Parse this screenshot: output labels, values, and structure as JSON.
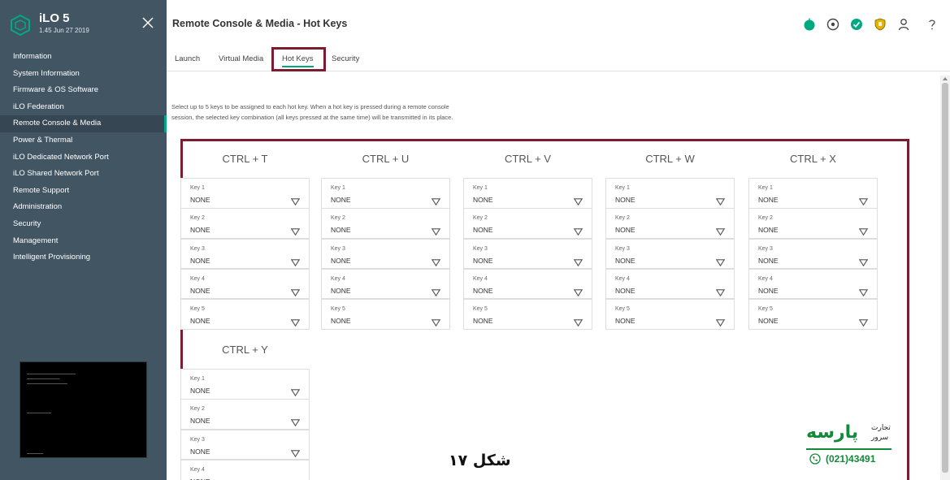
{
  "sidebar": {
    "app_name": "iLO 5",
    "version": "1.45 Jun 27 2019",
    "nav": [
      {
        "label": "Information",
        "active": false
      },
      {
        "label": "System Information",
        "active": false
      },
      {
        "label": "Firmware & OS Software",
        "active": false
      },
      {
        "label": "iLO Federation",
        "active": false
      },
      {
        "label": "Remote Console & Media",
        "active": true
      },
      {
        "label": "Power & Thermal",
        "active": false
      },
      {
        "label": "iLO Dedicated Network Port",
        "active": false
      },
      {
        "label": "iLO Shared Network Port",
        "active": false
      },
      {
        "label": "Remote Support",
        "active": false
      },
      {
        "label": "Administration",
        "active": false
      },
      {
        "label": "Security",
        "active": false
      },
      {
        "label": "Management",
        "active": false
      },
      {
        "label": "Intelligent Provisioning",
        "active": false
      }
    ]
  },
  "header": {
    "title": "Remote Console & Media - Hot Keys",
    "icons": [
      "health-status-icon",
      "target-icon",
      "check-status-icon",
      "security-shield-icon",
      "user-icon",
      "help-icon"
    ],
    "colors": {
      "health": "#01a982",
      "check": "#01a982",
      "shield": "#e6b400"
    }
  },
  "tabs": [
    {
      "label": "Launch",
      "active": false
    },
    {
      "label": "Virtual Media",
      "active": false
    },
    {
      "label": "Hot Keys",
      "active": true
    },
    {
      "label": "Security",
      "active": false
    }
  ],
  "main": {
    "description": "Select up to 5 keys to be assigned to each hot key. When a hot key is pressed during a remote console session, the selected key combination (all keys pressed at the same time) will be transmitted in its place.",
    "hotkeys": [
      {
        "title": "CTRL + T",
        "keys": [
          {
            "label": "Key 1",
            "value": "NONE"
          },
          {
            "label": "Key 2",
            "value": "NONE"
          },
          {
            "label": "Key 3",
            "value": "NONE"
          },
          {
            "label": "Key 4",
            "value": "NONE"
          },
          {
            "label": "Key 5",
            "value": "NONE"
          }
        ]
      },
      {
        "title": "CTRL + U",
        "keys": [
          {
            "label": "Key 1",
            "value": "NONE"
          },
          {
            "label": "Key 2",
            "value": "NONE"
          },
          {
            "label": "Key 3",
            "value": "NONE"
          },
          {
            "label": "Key 4",
            "value": "NONE"
          },
          {
            "label": "Key 5",
            "value": "NONE"
          }
        ]
      },
      {
        "title": "CTRL + V",
        "keys": [
          {
            "label": "Key 1",
            "value": "NONE"
          },
          {
            "label": "Key 2",
            "value": "NONE"
          },
          {
            "label": "Key 3",
            "value": "NONE"
          },
          {
            "label": "Key 4",
            "value": "NONE"
          },
          {
            "label": "Key 5",
            "value": "NONE"
          }
        ]
      },
      {
        "title": "CTRL + W",
        "keys": [
          {
            "label": "Key 1",
            "value": "NONE"
          },
          {
            "label": "Key 2",
            "value": "NONE"
          },
          {
            "label": "Key 3",
            "value": "NONE"
          },
          {
            "label": "Key 4",
            "value": "NONE"
          },
          {
            "label": "Key 5",
            "value": "NONE"
          }
        ]
      },
      {
        "title": "CTRL + X",
        "keys": [
          {
            "label": "Key 1",
            "value": "NONE"
          },
          {
            "label": "Key 2",
            "value": "NONE"
          },
          {
            "label": "Key 3",
            "value": "NONE"
          },
          {
            "label": "Key 4",
            "value": "NONE"
          },
          {
            "label": "Key 5",
            "value": "NONE"
          }
        ]
      },
      {
        "title": "CTRL + Y",
        "keys": [
          {
            "label": "Key 1",
            "value": "NONE"
          },
          {
            "label": "Key 2",
            "value": "NONE"
          },
          {
            "label": "Key 3",
            "value": "NONE"
          },
          {
            "label": "Key 4",
            "value": "NONE"
          }
        ]
      }
    ]
  },
  "overlay": {
    "caption": "شکل ۱۷",
    "logo_name": "پارسه",
    "logo_sub1": "تجارت",
    "logo_sub2": "سرور",
    "logo_phone": "(021)43491",
    "highlight_color": "#7c1c2f",
    "brand_color": "#13893a"
  }
}
